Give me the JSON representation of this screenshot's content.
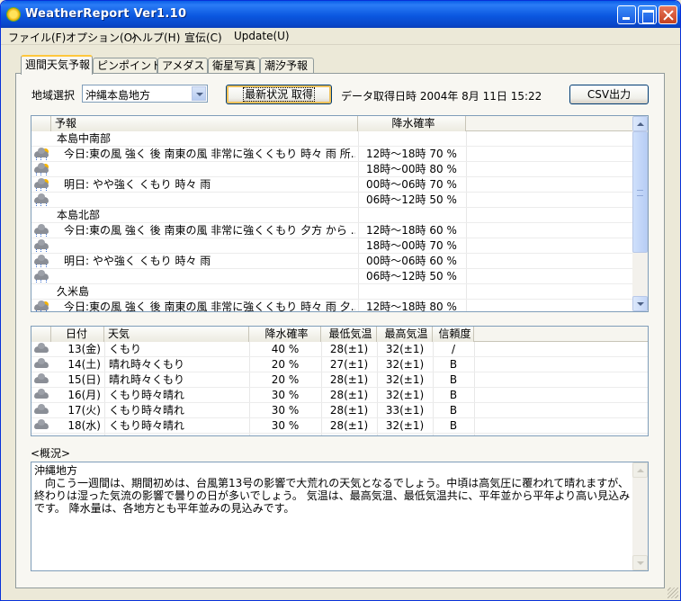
{
  "window": {
    "title": "WeatherReport Ver1.10"
  },
  "menu": [
    "ファイル(F)",
    "オプション(O)",
    "ヘルプ(H)",
    "宣伝(C)",
    "Update(U)"
  ],
  "tabs": [
    "週間天気予報",
    "ピンポイント",
    "アメダス",
    "衛星写真",
    "潮汐予報"
  ],
  "controls": {
    "region_label": "地域選択",
    "region_value": "沖縄本島地方",
    "refresh_button": "最新状況 取得",
    "acquired_text": "データ取得日時  2004年 8月 11日  15:22",
    "csv_button": "CSV出力"
  },
  "forecast_table": {
    "headers": [
      "予報",
      "降水確率"
    ],
    "rows": [
      {
        "kind": "area",
        "text": "本島中南部",
        "icon": ""
      },
      {
        "kind": "detail",
        "text": "今日:東の風 強く 後 南東の風 非常に強くくもり 時々 雨 所...",
        "prob": "12時～18時  70 %",
        "icon": "cloud-sun-rain-icon"
      },
      {
        "kind": "detail",
        "text": "",
        "prob": "18時～00時  80 %",
        "icon": "cloud-sun-rain-icon"
      },
      {
        "kind": "detail",
        "text": "明日: やや強く くもり 時々 雨",
        "prob": "00時～06時  70 %",
        "icon": "cloud-sun-rain-icon"
      },
      {
        "kind": "detail",
        "text": "",
        "prob": "06時～12時  50 %",
        "icon": "cloud-rain-icon"
      },
      {
        "kind": "area",
        "text": "本島北部",
        "icon": ""
      },
      {
        "kind": "detail",
        "text": "今日:東の風 強く 後 南東の風 非常に強くくもり 夕方 から ...",
        "prob": "12時～18時  60 %",
        "icon": "cloud-rain-icon"
      },
      {
        "kind": "detail",
        "text": "",
        "prob": "18時～00時  70 %",
        "icon": "cloud-rain-icon"
      },
      {
        "kind": "detail",
        "text": "明日: やや強く くもり 時々 雨",
        "prob": "00時～06時  60 %",
        "icon": "cloud-rain-icon"
      },
      {
        "kind": "detail",
        "text": "",
        "prob": "06時～12時  50 %",
        "icon": "cloud-rain-icon"
      },
      {
        "kind": "area",
        "text": "久米島",
        "icon": ""
      },
      {
        "kind": "detail",
        "text": "今日:東の風 強く 後 南東の風 非常に強くくもり 時々 雨 夕...",
        "prob": "12時～18時  80 %",
        "icon": "cloud-sun-rain-icon"
      }
    ]
  },
  "weekly_table": {
    "headers": [
      "日付",
      "天気",
      "降水確率",
      "最低気温",
      "最高気温",
      "信頼度"
    ],
    "rows": [
      {
        "date": "13(金)",
        "weather": "くもり",
        "prob": "40 %",
        "low": "28(±1)",
        "high": "32(±1)",
        "rel": "/",
        "icon": "cloud-icon"
      },
      {
        "date": "14(土)",
        "weather": "晴れ時々くもり",
        "prob": "20 %",
        "low": "27(±1)",
        "high": "32(±1)",
        "rel": "B",
        "icon": "cloud-icon"
      },
      {
        "date": "15(日)",
        "weather": "晴れ時々くもり",
        "prob": "20 %",
        "low": "28(±1)",
        "high": "32(±1)",
        "rel": "B",
        "icon": "cloud-icon"
      },
      {
        "date": "16(月)",
        "weather": "くもり時々晴れ",
        "prob": "30 %",
        "low": "28(±1)",
        "high": "32(±1)",
        "rel": "B",
        "icon": "cloud-icon"
      },
      {
        "date": "17(火)",
        "weather": "くもり時々晴れ",
        "prob": "30 %",
        "low": "28(±1)",
        "high": "33(±1)",
        "rel": "B",
        "icon": "cloud-icon"
      },
      {
        "date": "18(水)",
        "weather": "くもり時々晴れ",
        "prob": "30 %",
        "low": "28(±1)",
        "high": "32(±1)",
        "rel": "B",
        "icon": "cloud-icon"
      }
    ]
  },
  "summary": {
    "label": "<概況>",
    "text": "沖縄地方\n　向こう一週間は、期間初めは、台風第13号の影響で大荒れの天気となるでしょう。中頃は高気圧に覆われて晴れますが、終わりは湿った気流の影響で曇りの日が多いでしょう。 気温は、最高気温、最低気温共に、平年並から平年より高い見込みです。 降水量は、各地方とも平年並みの見込みです。"
  }
}
